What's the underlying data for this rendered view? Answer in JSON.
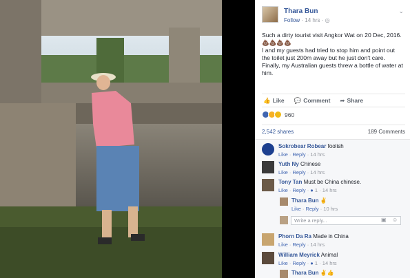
{
  "post": {
    "author": "Thara Bun",
    "follow_label": "Follow",
    "time": "· 14 hrs ·",
    "globe_icon": "globe-icon",
    "text_line1": "Such a dirty tourist visit Angkor Wat on 20 Dec, 2016.💩💩💩💩",
    "text_line2": "I and my guests had tried to stop him and point out the toilet just 200m away but he just don't care. Finally, my Australian guests threw a bottle of water at him."
  },
  "actions": {
    "like": "Like",
    "comment": "Comment",
    "share": "Share"
  },
  "reactions": {
    "count": "960"
  },
  "stats": {
    "shares": "2,542 shares",
    "comments": "189 Comments"
  },
  "comments": [
    {
      "name": "Sokrobear Robear",
      "text": "foolish",
      "like": "Like",
      "reply": "Reply",
      "time": "· 14 hrs"
    },
    {
      "name": "Yuth Ny",
      "text": "Chinese",
      "like": "Like",
      "reply": "Reply",
      "time": "· 14 hrs"
    },
    {
      "name": "Tony Tan",
      "text": "Must be China chinese.",
      "like": "Like",
      "reply": "Reply",
      "likes": "1",
      "time": "· 14 hrs"
    },
    {
      "name": "Phorn Da Ra",
      "text": "Made in China",
      "like": "Like",
      "reply": "Reply",
      "time": "· 14 hrs"
    },
    {
      "name": "William Meyrick",
      "text": "Animal",
      "like": "Like",
      "reply": "Reply",
      "likes": "1",
      "time": "· 14 hrs"
    }
  ],
  "replies": [
    {
      "name": "Thara Bun",
      "text": "✌",
      "like": "Like",
      "reply": "Reply",
      "time": "· 10 hrs"
    },
    {
      "name": "Thara Bun",
      "text": "✌👍"
    }
  ],
  "reply_box": {
    "placeholder": "Write a reply..."
  }
}
